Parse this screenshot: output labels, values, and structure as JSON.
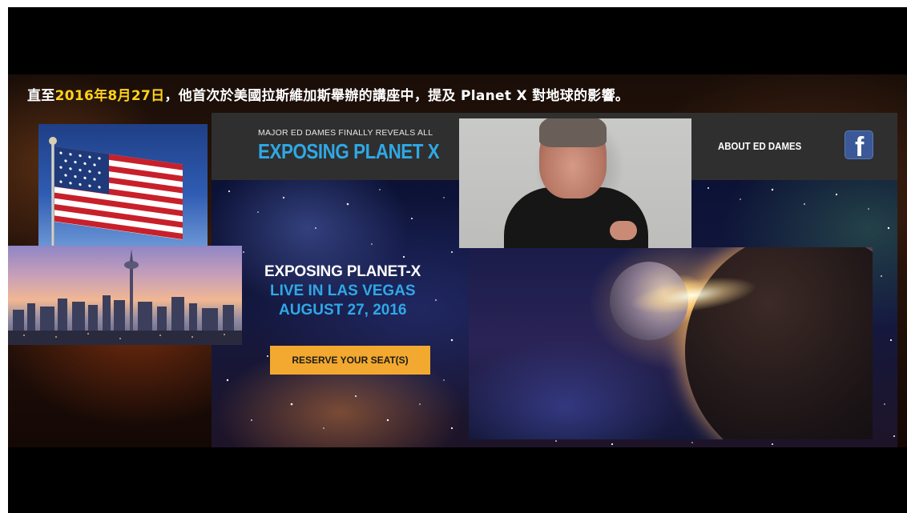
{
  "headline": {
    "prefix": "直至",
    "date": "2016年8月27日",
    "suffix": "，他首次於美國拉斯維加斯舉辦的講座中，提及 Planet X 對地球的影響。"
  },
  "header": {
    "tagline": "MAJOR ED DAMES FINALLY REVEALS ALL",
    "title": "EXPOSING PLANET X",
    "nav_about": "ABOUT ED DAMES",
    "facebook_glyph": "f"
  },
  "hero": {
    "title": "EXPOSING PLANET-X",
    "subtitle_line1": "LIVE IN LAS VEGAS",
    "subtitle_line2": "AUGUST 27, 2016",
    "cta_label": "RESERVE YOUR SEAT(S)"
  },
  "colors": {
    "accent_blue": "#2fa8e6",
    "cta_orange": "#f3a92f",
    "headline_yellow": "#ffd31a",
    "header_bar": "#2f2f2f",
    "facebook_blue": "#3b5998"
  },
  "icons": {
    "facebook": "facebook-icon"
  }
}
